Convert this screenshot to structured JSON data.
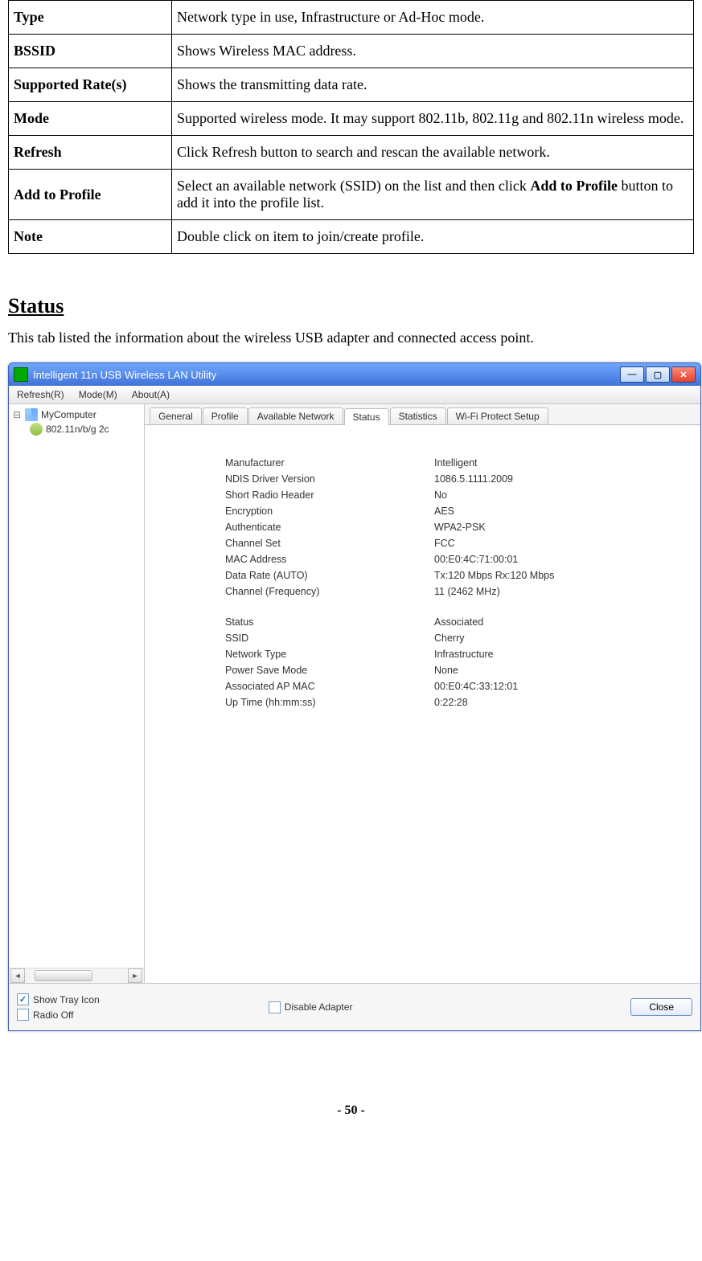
{
  "definitions": [
    {
      "term": "Type",
      "desc": "Network type in use, Infrastructure or Ad-Hoc mode."
    },
    {
      "term": "BSSID",
      "desc": "Shows Wireless MAC address."
    },
    {
      "term": "Supported Rate(s)",
      "desc": "Shows the transmitting data rate."
    },
    {
      "term": "Mode",
      "desc": "Supported wireless mode. It may support 802.11b, 802.11g and 802.11n wireless mode."
    },
    {
      "term": "Refresh",
      "desc": "Click Refresh button to search and rescan the available network."
    },
    {
      "term": "Add to Profile",
      "desc_pre": "Select an available network (SSID) on the list and then click ",
      "desc_bold": "Add to Profile",
      "desc_post": " button to add it into the profile list."
    },
    {
      "term": "Note",
      "desc": "Double click on item to join/create profile."
    }
  ],
  "section_title": "Status",
  "section_intro": "This tab listed the information about the wireless USB adapter and connected access point.",
  "window": {
    "title": "Intelligent 11n USB Wireless LAN Utility",
    "menus": {
      "refresh": "Refresh(R)",
      "mode": "Mode(M)",
      "about": "About(A)"
    },
    "tree": {
      "root": "MyComputer",
      "child": "802.11n/b/g 2c"
    },
    "tabs": [
      "General",
      "Profile",
      "Available Network",
      "Status",
      "Statistics",
      "Wi-Fi Protect Setup"
    ],
    "active_tab": "Status",
    "status_rows_a": [
      {
        "k": "Manufacturer",
        "v": "Intelligent"
      },
      {
        "k": "NDIS Driver Version",
        "v": "1086.5.1111.2009"
      },
      {
        "k": "Short Radio Header",
        "v": "No"
      },
      {
        "k": "Encryption",
        "v": "AES"
      },
      {
        "k": "Authenticate",
        "v": "WPA2-PSK"
      },
      {
        "k": "Channel Set",
        "v": "FCC"
      },
      {
        "k": "MAC Address",
        "v": "00:E0:4C:71:00:01"
      },
      {
        "k": "Data Rate (AUTO)",
        "v": "Tx:120 Mbps Rx:120 Mbps"
      },
      {
        "k": "Channel (Frequency)",
        "v": "11 (2462 MHz)"
      }
    ],
    "status_rows_b": [
      {
        "k": "Status",
        "v": "Associated"
      },
      {
        "k": "SSID",
        "v": "Cherry"
      },
      {
        "k": "Network Type",
        "v": "Infrastructure"
      },
      {
        "k": "Power Save Mode",
        "v": "None"
      },
      {
        "k": "Associated AP MAC",
        "v": "00:E0:4C:33:12:01"
      },
      {
        "k": "Up Time (hh:mm:ss)",
        "v": "0:22:28"
      }
    ],
    "bottom": {
      "show_tray": "Show Tray Icon",
      "radio_off": "Radio Off",
      "disable_adapter": "Disable Adapter",
      "close": "Close"
    }
  },
  "page_number": "- 50 -"
}
